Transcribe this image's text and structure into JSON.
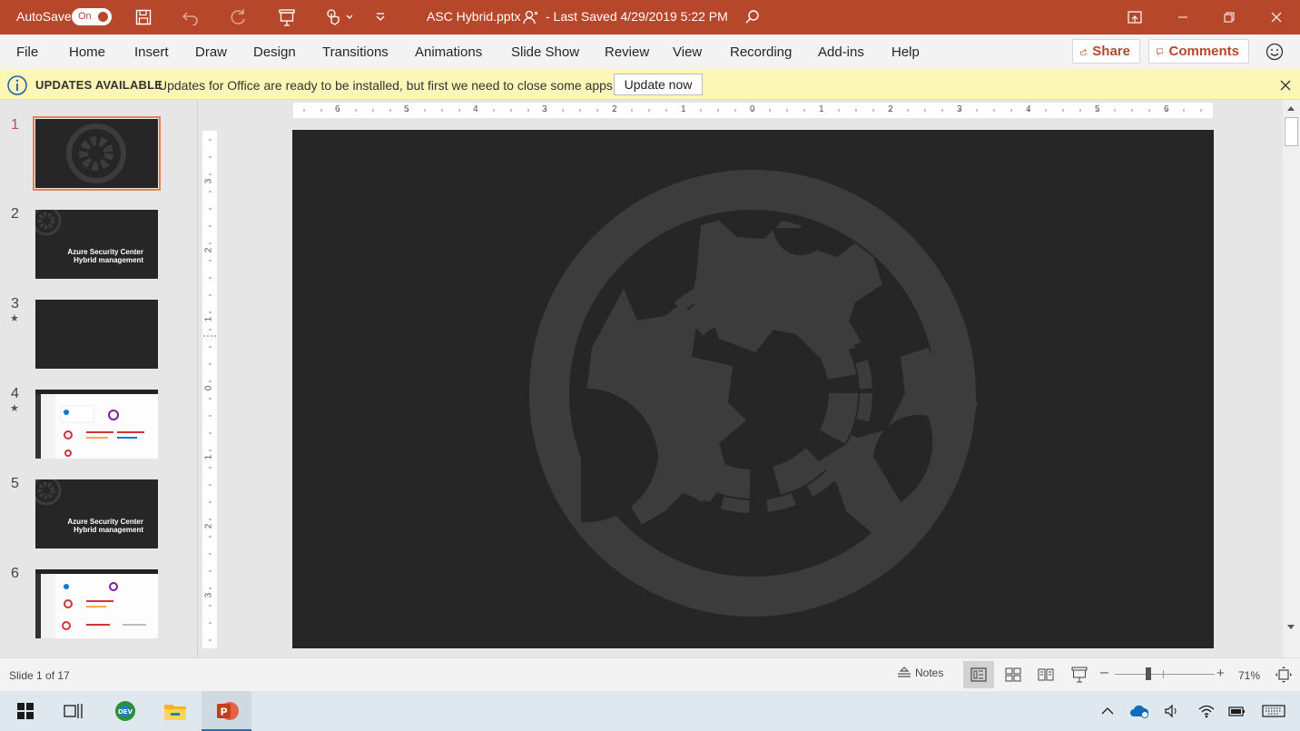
{
  "titlebar": {
    "autosave_label": "AutoSave",
    "autosave_state": "On",
    "filename": "ASC Hybrid.pptx",
    "saved_status": "-  Last Saved 4/29/2019 5:22 PM"
  },
  "ribbon": {
    "tabs": [
      "File",
      "Home",
      "Insert",
      "Draw",
      "Design",
      "Transitions",
      "Animations",
      "Slide Show",
      "Review",
      "View",
      "Recording",
      "Add-ins",
      "Help"
    ],
    "share_label": "Share",
    "comments_label": "Comments"
  },
  "update_bar": {
    "title": "UPDATES AVAILABLE",
    "message": "Updates for Office are ready to be installed, but first we need to close some apps.",
    "button_label": "Update now"
  },
  "thumbnails": [
    {
      "number": "1",
      "kind": "logo",
      "selected": true
    },
    {
      "number": "2",
      "kind": "title",
      "line1": "Azure Security Center",
      "line2": "Hybrid management"
    },
    {
      "number": "3",
      "kind": "dark",
      "star": "★"
    },
    {
      "number": "4",
      "kind": "screenshot",
      "star": "★"
    },
    {
      "number": "5",
      "kind": "title",
      "line1": "Azure Security Center",
      "line2": "Hybrid management"
    },
    {
      "number": "6",
      "kind": "screenshot"
    }
  ],
  "rulers": {
    "horizontal": [
      "6",
      "5",
      "4",
      "3",
      "2",
      "1",
      "0",
      "1",
      "2",
      "3",
      "4",
      "5",
      "6"
    ],
    "vertical": [
      "3",
      "2",
      "1",
      "0",
      "1",
      "2",
      "3"
    ]
  },
  "statusbar": {
    "slide_info": "Slide 1 of 17",
    "notes_label": "Notes",
    "zoom": "71%"
  },
  "colors": {
    "accent": "#b7472a",
    "slide_bg": "#262626",
    "logo": "#3c3c3c"
  }
}
